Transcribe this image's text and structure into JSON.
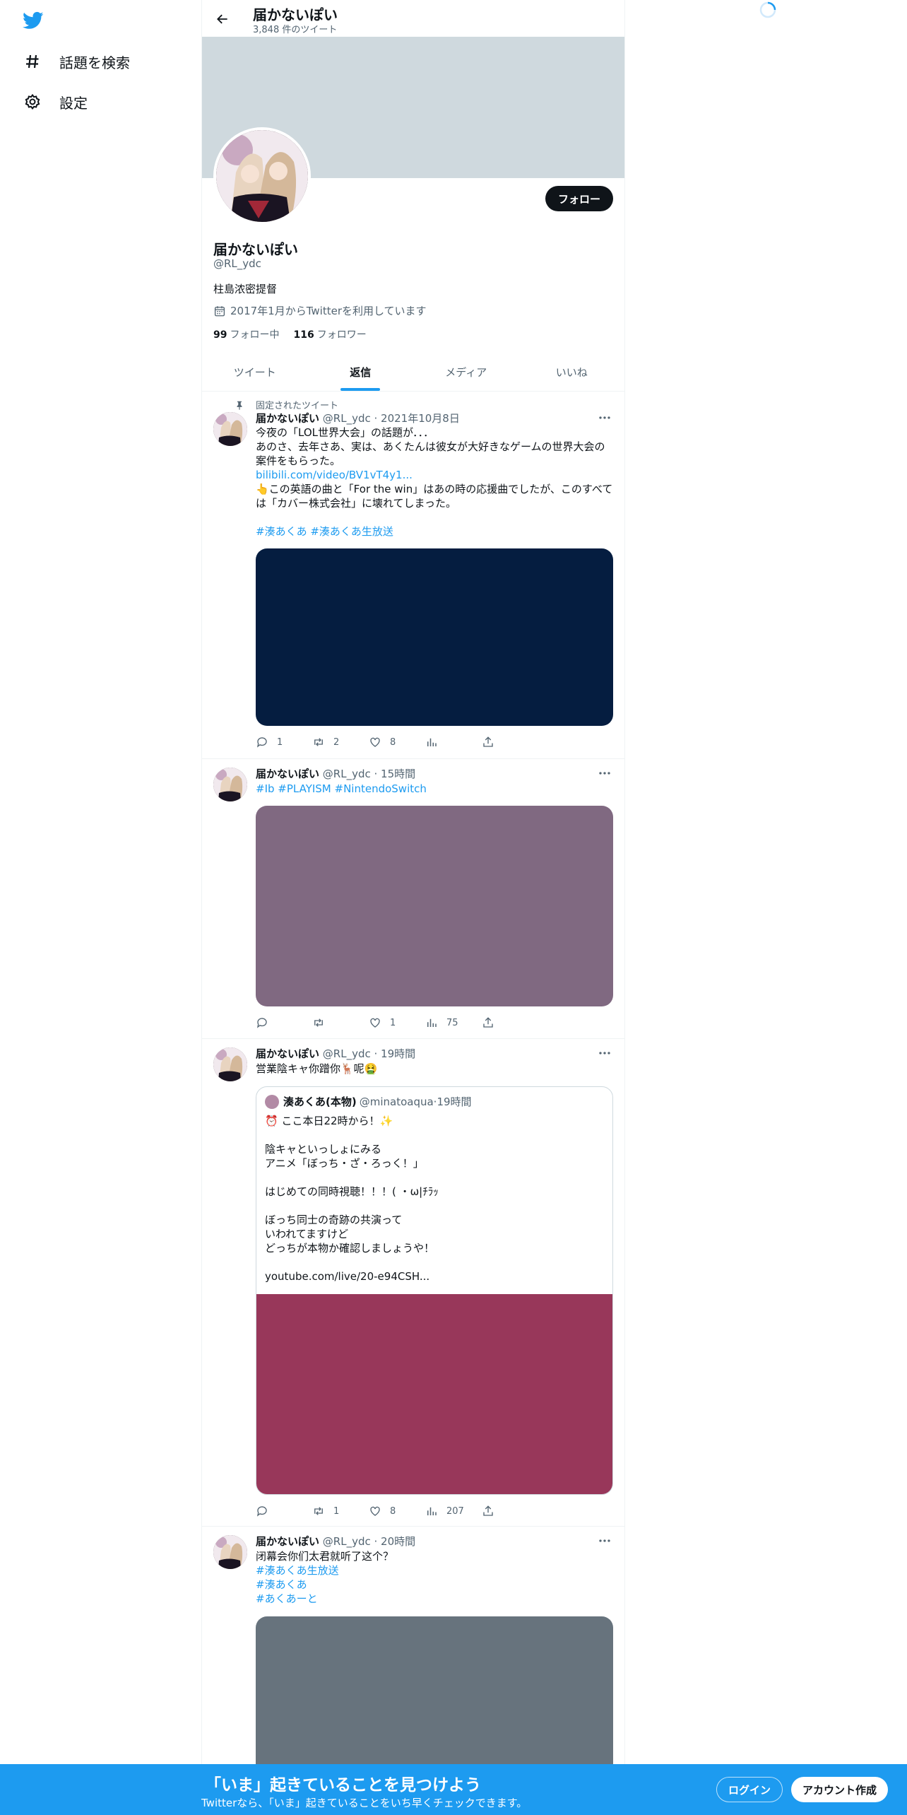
{
  "sidebar": {
    "logo_icon": "twitter-bird-icon",
    "items": [
      {
        "icon": "hashtag-icon",
        "label": "話題を検索"
      },
      {
        "icon": "gear-icon",
        "label": "設定"
      }
    ]
  },
  "header": {
    "name": "届かないぽい",
    "tweet_count": "3,848 件のツイート"
  },
  "profile": {
    "name": "届かないぽい",
    "handle": "@RL_ydc",
    "bio": "柱島浓密提督",
    "joined": "2017年1月からTwitterを利用しています",
    "following_count": "99",
    "following_label": "フォロー中",
    "followers_count": "116",
    "followers_label": "フォロワー",
    "follow_button": "フォロー"
  },
  "tabs": [
    "ツイート",
    "返信",
    "メディア",
    "いいね"
  ],
  "active_tab": "返信",
  "colors": {
    "accent": "#1d9bf0",
    "banner": "#cfd9de",
    "media1": "#051d40",
    "media2": "#806981",
    "media3": "#98375a",
    "media4": "#67737d"
  },
  "tweets": [
    {
      "pinned_label": "固定されたツイート",
      "name": "届かないぽい",
      "handle": "@RL_ydc",
      "time": "2021年10月8日",
      "lines": [
        "今夜の「LOL世界大会」の話題が．．．",
        "あのさ、去年さあ、実は、あくたんは彼女が大好きなゲームの世界大会の",
        "案件をもらった。"
      ],
      "link": "bilibili.com/video/BV1vT4y1...",
      "lines2": [
        "👆この英語の曲と「For the win」はあの時の応援曲でしたが、このすべて",
        "は「カバー株式会社」に壊れてしまった。"
      ],
      "hashtags": "#湊あくあ #湊あくあ生放送",
      "reply": "1",
      "retweet": "2",
      "like": "8",
      "views": ""
    },
    {
      "name": "届かないぽい",
      "handle": "@RL_ydc",
      "time": "15時間",
      "hashtags": "#Ib #PLAYISM #NintendoSwitch",
      "reply": "",
      "retweet": "",
      "like": "1",
      "views": "75"
    },
    {
      "name": "届かないぽい",
      "handle": "@RL_ydc",
      "time": "19時間",
      "text": "営業陰キャ你蹭你🦌呢🤮",
      "quote": {
        "name": "湊あくあ(本物)",
        "handle": "@minatoaqua",
        "time": "19時間",
        "lines": [
          "⏰ ここ本日22時から！✨",
          "",
          "陰キャといっしょにみる",
          "アニメ「ぼっち・ざ・ろっく！」",
          "",
          "はじめての同時視聴！！！( ・ω|ﾁﾗｯ",
          "",
          "ぼっち同士の奇跡の共演って",
          "いわれてますけど",
          "どっちが本物か確認しましょうや！",
          "",
          "youtube.com/live/20-e94CSH..."
        ]
      },
      "reply": "",
      "retweet": "1",
      "like": "8",
      "views": "207"
    },
    {
      "name": "届かないぽい",
      "handle": "@RL_ydc",
      "time": "20時間",
      "text": "闭幕会你们太君就听了这个？",
      "hashtag_lines": [
        "#湊あくあ生放送",
        "#湊あくあ",
        "#あくあーと"
      ]
    }
  ],
  "bottom_bar": {
    "title": "「いま」起きていることを見つけよう",
    "subtitle": "Twitterなら、「いま」起きていることをいち早くチェックできます。",
    "login": "ログイン",
    "signup": "アカウント作成"
  }
}
